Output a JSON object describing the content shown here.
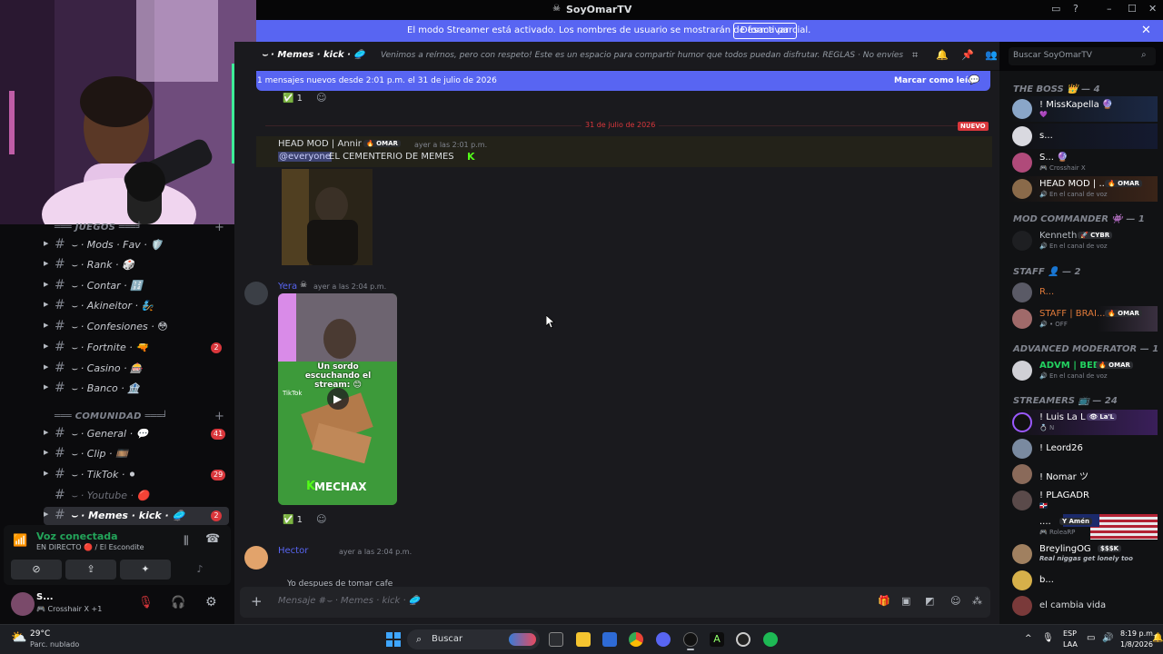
{
  "window": {
    "title": "SoyOmarTV"
  },
  "banner": {
    "text": "El modo Streamer está activado. Los nombres de usuario se mostrarán de forma parcial.",
    "button": "Desactivar",
    "close": "✕"
  },
  "header": {
    "channel": "⌣ · Memes · kick · 🥏",
    "topic": "Venimos a reírnos, pero con respeto! Este es un espacio para compartir humor que todos puedan disfrutar. REGLAS · No envíes memes que ...",
    "search_placeholder": "Buscar SoyOmarTV"
  },
  "new_messages": {
    "text": "1 mensajes nuevos desde 2:01 p.m. el 31 de julio de 2026",
    "action": "Marcar como leído"
  },
  "sidebar": {
    "categories": [
      {
        "name": "═══ JUEGOS ═══╛"
      },
      {
        "name": "═══ COMUNIDAD ═══╛"
      }
    ],
    "channels": [
      {
        "label": "⌣ · Mods · Fav · 🛡️",
        "badge": ""
      },
      {
        "label": "⌣ · Rank · 🎲",
        "badge": ""
      },
      {
        "label": "⌣ · Contar · 🔢",
        "badge": ""
      },
      {
        "label": "⌣ · Akineitor · 🧞",
        "badge": ""
      },
      {
        "label": "⌣ · Confesiones · 😳",
        "badge": ""
      },
      {
        "label": "⌣ · Fortnite · 🔫",
        "badge": "2"
      },
      {
        "label": "⌣ · Casino · 🎰",
        "badge": ""
      },
      {
        "label": "⌣ · Banco · 🏦",
        "badge": ""
      },
      {
        "label": "⌣ · General · 💬",
        "badge": "41"
      },
      {
        "label": "⌣ · Clip · 🎞️",
        "badge": ""
      },
      {
        "label": "⌣ · TikTok · ⚫",
        "badge": "29"
      },
      {
        "label": "⌣ · Youtube · 🔴",
        "badge": ""
      },
      {
        "label": "⌣ · Memes · kick · 🥏",
        "badge": "2"
      }
    ],
    "voice": {
      "title": "Voz conectada",
      "subtitle": "EN DIRECTO 🔴 / El Escondite"
    },
    "user": {
      "name": "S...",
      "status": "🎮 Crosshair X +1"
    }
  },
  "messages": {
    "date_divider": "31 de julio de 2026",
    "new_label": "NUEVO",
    "reaction_count": "1",
    "msg1": {
      "author": "HEAD MOD | Annir",
      "tag": "🔥 OMAR",
      "time": "ayer a las 2:01 p.m.",
      "mention": "@everyone",
      "text": "EL CEMENTERIO DE MEMES"
    },
    "msg2": {
      "author": "Yera",
      "time": "ayer a las 2:04 p.m.",
      "video_caption": "Un sordo escuchando el stream: 😊",
      "video_brand": "MECHAX",
      "tiktok": "TikTok"
    },
    "msg3": {
      "author": "Hector",
      "time": "ayer a las 2:04 p.m.",
      "text": "Yo despues de tomar cafe"
    },
    "composer_placeholder": "Mensaje #⌣ · Memes · kick · 🥏"
  },
  "members": {
    "roles": [
      "THE BOSS 👑 — 4",
      "MOD COMMANDER 👾 — 1",
      "STAFF 👤 — 2",
      "ADVANCED MODERATOR — 1",
      "STREAMERS 📺 — 24"
    ],
    "list": [
      {
        "name": "! MissKapella 🔮",
        "sub": "💜",
        "tag": ""
      },
      {
        "name": "s...",
        "sub": "",
        "tag": ""
      },
      {
        "name": "S... 🔮",
        "sub": "🎮 Crosshair X",
        "tag": ""
      },
      {
        "name": "HEAD MOD | ...",
        "sub": "🔊 En el canal de voz",
        "tag": "🔥 OMAR"
      },
      {
        "name": "Kenneth",
        "sub": "🔊 En el canal de voz",
        "tag": "🚀 CYBR"
      },
      {
        "name": "R...",
        "sub": "",
        "tag": ""
      },
      {
        "name": "STAFF | BRAI...",
        "sub": "🔊 • OFF",
        "tag": "🔥 OMAR"
      },
      {
        "name": "ADVM | BEBO",
        "sub": "🔊 En el canal de voz",
        "tag": "🔥 OMAR"
      },
      {
        "name": "! Luis La L",
        "sub": "💍 N",
        "tag": "👁 La'L"
      },
      {
        "name": "! Leord26",
        "sub": "",
        "tag": ""
      },
      {
        "name": "! Nomar ツ",
        "sub": "",
        "tag": ""
      },
      {
        "name": "! PLAGADR",
        "sub": "🇩🇴",
        "tag": ""
      },
      {
        "name": "....",
        "sub": "🎮 RoleaRP",
        "tag": "Y Amén"
      },
      {
        "name": "BreylingOG",
        "sub": "Real niggas get lonely too",
        "tag": "$$$K"
      },
      {
        "name": "b...",
        "sub": "",
        "tag": ""
      },
      {
        "name": "el cambia vida",
        "sub": "",
        "tag": ""
      }
    ]
  },
  "taskbar": {
    "weather_temp": "29°C",
    "weather_desc": "Parc. nublado",
    "search": "Buscar",
    "lang1": "ESP",
    "lang2": "LAA",
    "time": "8:19 p.m.",
    "date": "1/8/2026"
  },
  "colors": {
    "blurple": "#5865f2",
    "green": "#23a55a",
    "red": "#da373c"
  }
}
